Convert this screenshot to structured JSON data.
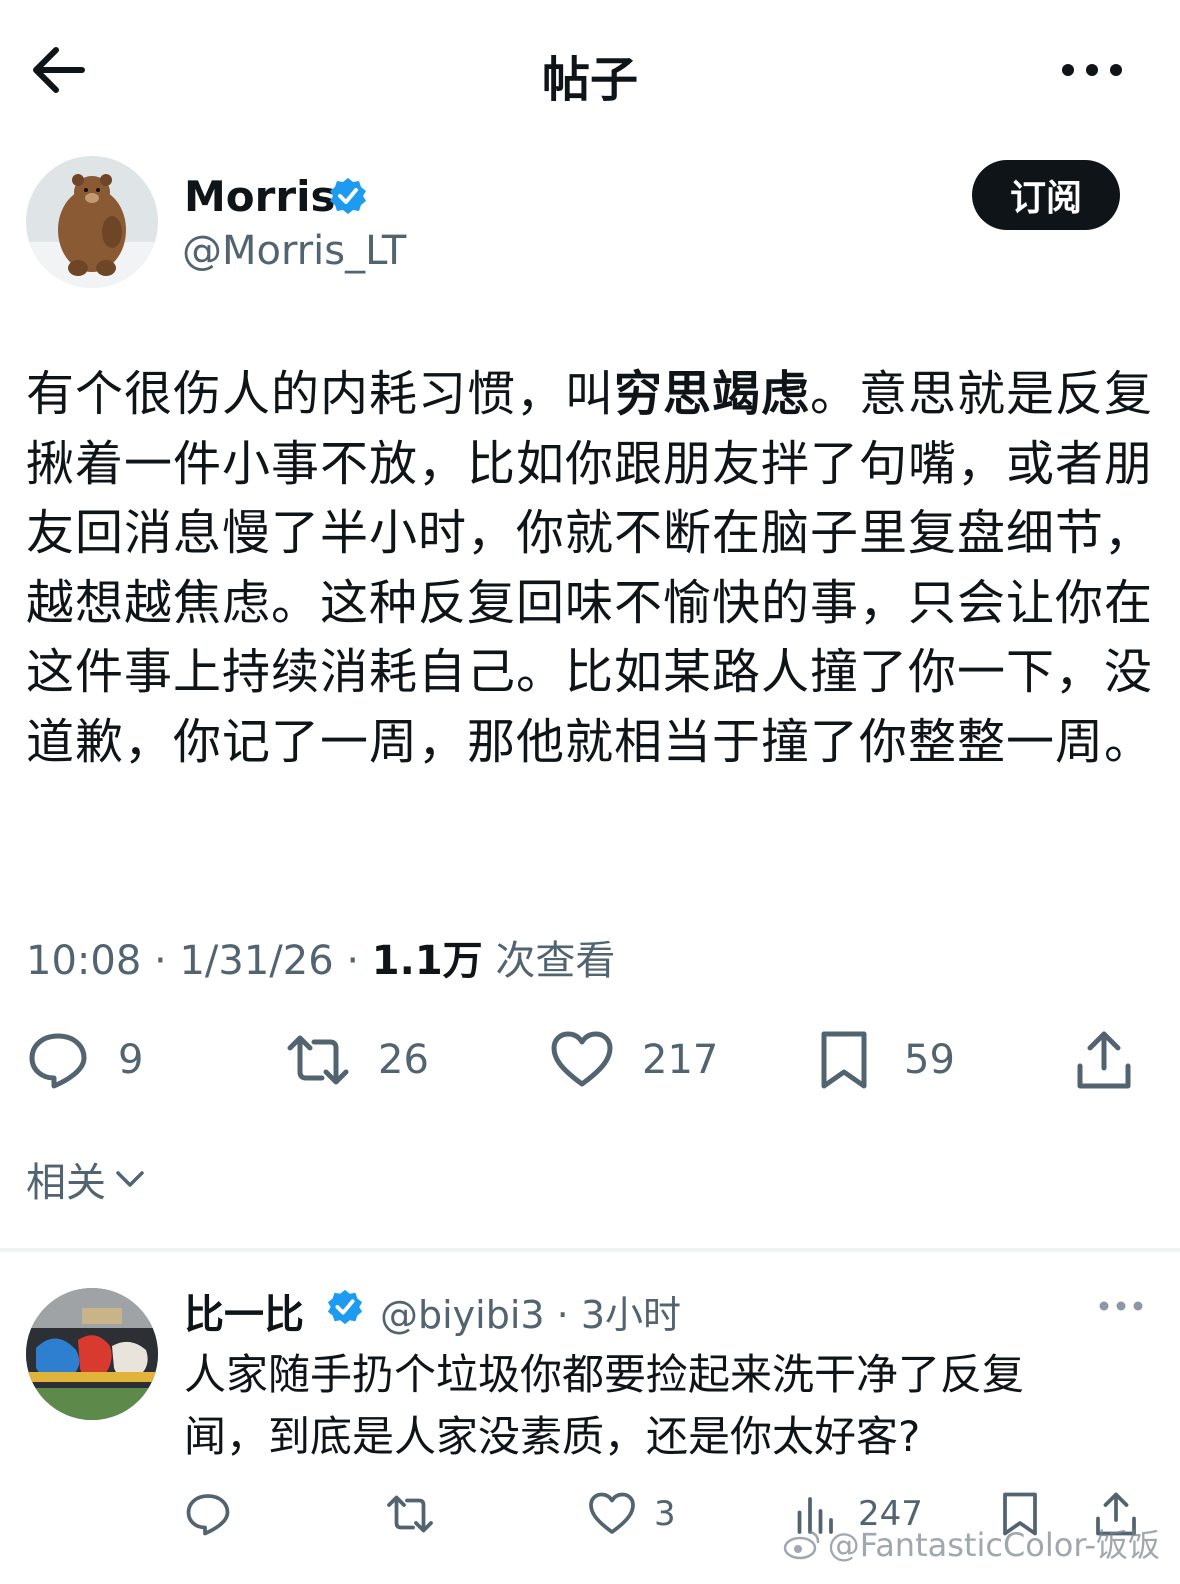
{
  "header": {
    "title": "帖子"
  },
  "post": {
    "author": {
      "name": "Morris",
      "handle": "@Morris_LT"
    },
    "subscribe_label": "订阅",
    "text_parts": [
      "有个很伤人的内耗习惯，叫",
      "穷思竭虑",
      "。意思就是反复揪着一件小事不放，比如你跟朋友拌了句嘴，或者朋友回消息慢了半小时，你就不断在脑子里复盘细节，越想越焦虑。这种反复回味不愉快的事，只会让你在这件事上持续消耗自己。比如某路人撞了你一下，没道歉，你记了一周，那他就相当于撞了你整整一周。"
    ],
    "time": "10:08",
    "date": "1/31/26",
    "views": "1.1万",
    "views_label": "次查看",
    "separator": "·",
    "stats": {
      "replies": "9",
      "reposts": "26",
      "likes": "217",
      "bookmarks": "59"
    }
  },
  "related_label": "相关",
  "reply": {
    "name": "比一比",
    "handle_time": "@biyibi3 · 3小时",
    "text": "人家随手扔个垃圾你都要捡起来洗干净了反复闻，到底是人家没素质，还是你太好客?",
    "likes": "3",
    "views": "247"
  },
  "watermark": "@FantasticColor-饭饭",
  "colors": {
    "text": "#0f1419",
    "secondary": "#536471",
    "verified": "#1d9bf0",
    "divider": "#eff3f4"
  }
}
